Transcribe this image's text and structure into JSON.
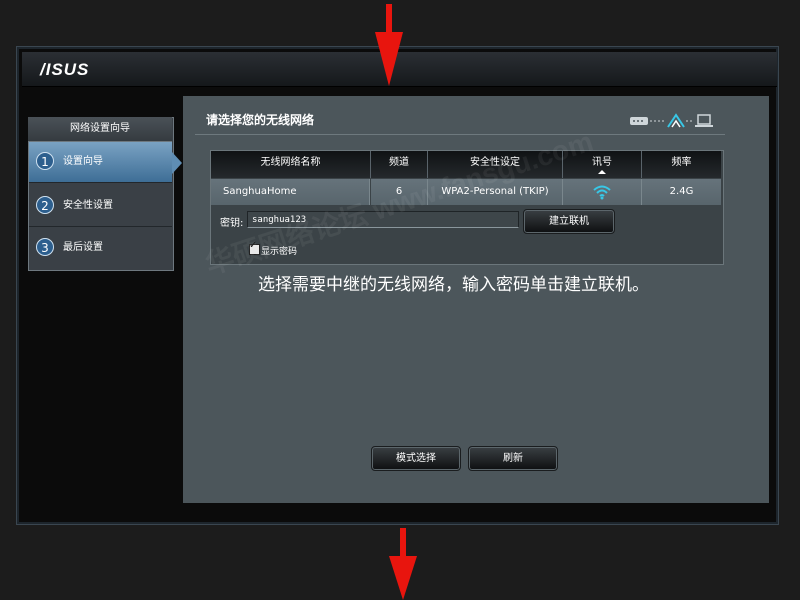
{
  "brand": {
    "logo": "/ISUS"
  },
  "sidebar": {
    "title": "网络设置向导",
    "items": [
      {
        "num": "1",
        "label": "设置向导",
        "active": true
      },
      {
        "num": "2",
        "label": "安全性设置",
        "active": false
      },
      {
        "num": "3",
        "label": "最后设置",
        "active": false
      }
    ]
  },
  "main": {
    "title": "请选择您的无线网络",
    "table": {
      "headers": [
        "无线网络名称",
        "频道",
        "安全性设定",
        "讯号",
        "频率"
      ],
      "rows": [
        {
          "name": "SanghuaHome",
          "channel": "6",
          "security": "WPA2-Personal (TKIP)",
          "signal_icon": "wifi-signal-icon",
          "frequency": "2.4G"
        }
      ]
    },
    "password": {
      "label": "密钥:",
      "value": "sanghua123"
    },
    "connect_button": "建立联机",
    "show_password": {
      "label": "显示密码",
      "checked": true
    },
    "mode_button": "模式选择",
    "refresh_button": "刷新"
  },
  "caption": "选择需要中继的无线网络，输入密码单击建立联机。",
  "watermark": "华硕网络论坛 www.fansgu.com",
  "colors": {
    "arrow": "#e8150e",
    "active_step": "#5f8db3",
    "signal": "#38c7e6",
    "panel": "#4c565b"
  }
}
